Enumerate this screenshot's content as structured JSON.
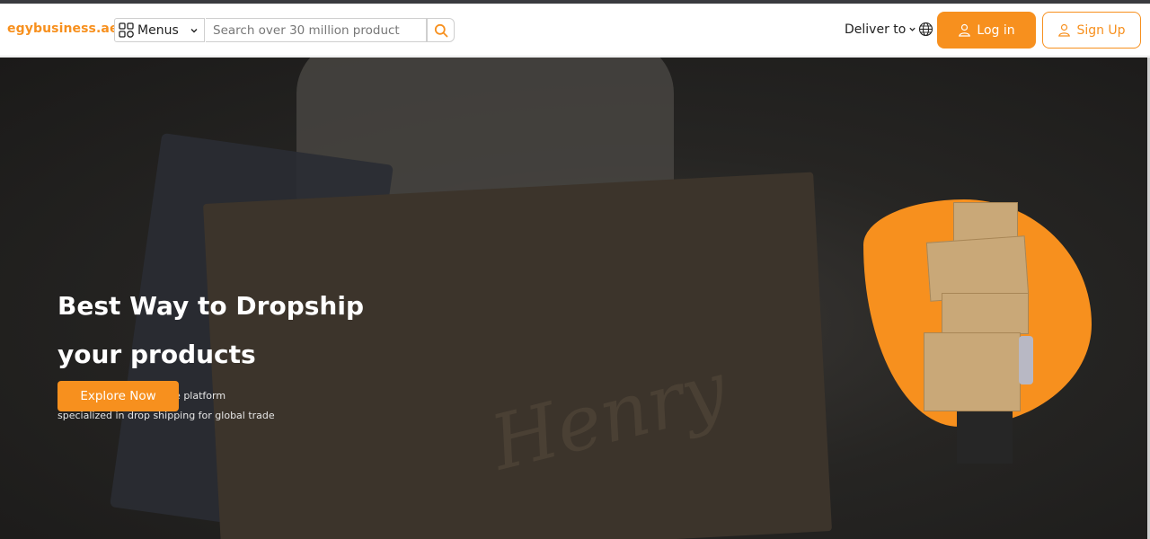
{
  "header": {
    "logo": "egybusiness.ae",
    "menus_label": "Menus",
    "search_placeholder": "Search over 30 million product",
    "deliver_label": "Deliver to",
    "login_label": "Log in",
    "signup_label": "Sign Up"
  },
  "hero": {
    "title_line1": "Best Way to Dropship",
    "title_line2": "your products",
    "subtitle_line1": "The leading e-commerce platform",
    "subtitle_line2": "specialized in drop shipping for global trade",
    "cta_label": "Explore Now",
    "bag_text": "Henry"
  },
  "colors": {
    "accent": "#f7901e",
    "hero_dark": "#262523"
  },
  "icons": [
    "grid-icon",
    "chevron-down-icon",
    "search-icon",
    "globe-icon",
    "user-icon"
  ]
}
